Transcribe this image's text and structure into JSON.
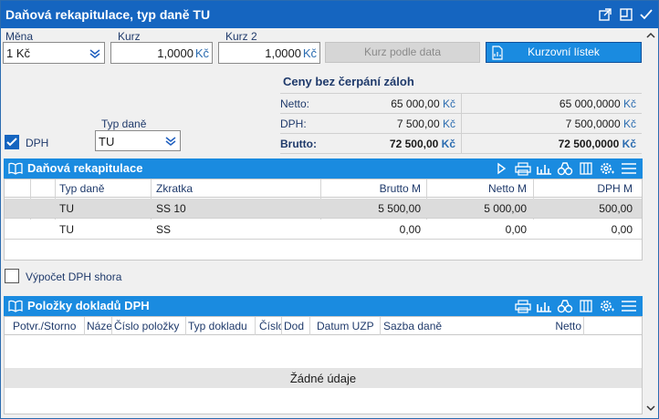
{
  "window": {
    "title": "Daňová rekapitulace, typ daně TU"
  },
  "currency": {
    "mena_label": "Měna",
    "mena_value": "1 Kč",
    "kurz_label": "Kurz",
    "kurz_value": "1,0000",
    "kurz_unit": "Kč",
    "kurz2_label": "Kurz 2",
    "kurz2_value": "1,0000",
    "kurz2_unit": "Kč",
    "kurz_podle_data_label": "Kurz podle data",
    "kurzovni_listek_label": "Kurzovní lístek"
  },
  "summary": {
    "title": "Ceny bez čerpání záloh",
    "rows": [
      {
        "label": "Netto:",
        "v1": "65 000,00",
        "u1": "Kč",
        "v2": "65 000,0000",
        "u2": "Kč"
      },
      {
        "label": "DPH:",
        "v1": "7 500,00",
        "u1": "Kč",
        "v2": "7 500,0000",
        "u2": "Kč"
      },
      {
        "label": "Brutto:",
        "v1": "72 500,00",
        "u1": "Kč",
        "v2": "72 500,0000",
        "u2": "Kč"
      }
    ]
  },
  "options": {
    "dph_label": "DPH",
    "dph_checked": true,
    "typ_dane_label": "Typ daně",
    "typ_dane_value": "TU"
  },
  "tax_recap": {
    "title": "Daňová rekapitulace",
    "columns": [
      "Typ daně",
      "Zkratka",
      "Brutto M",
      "Netto M",
      "DPH M"
    ],
    "rows": [
      [
        "TU",
        "SS 10",
        "5 500,00",
        "5 000,00",
        "500,00"
      ],
      [
        "TU",
        "SS",
        "0,00",
        "0,00",
        "0,00"
      ]
    ]
  },
  "vypocet": {
    "label": "Výpočet DPH shora",
    "checked": false
  },
  "items": {
    "title": "Položky dokladů DPH",
    "columns": [
      "Potvr./Storno",
      "Náze",
      "Číslo položky",
      "Typ dokladu",
      "Číslo",
      "Dod",
      "Datum UZP",
      "Sazba daně",
      "Netto"
    ],
    "empty_text": "Žádné údaje"
  },
  "colors": {
    "titlebar": "#1565c0",
    "panelbar": "#1a8be0",
    "accent_button": "#1a8be0",
    "label_text": "#1f3a6b"
  }
}
